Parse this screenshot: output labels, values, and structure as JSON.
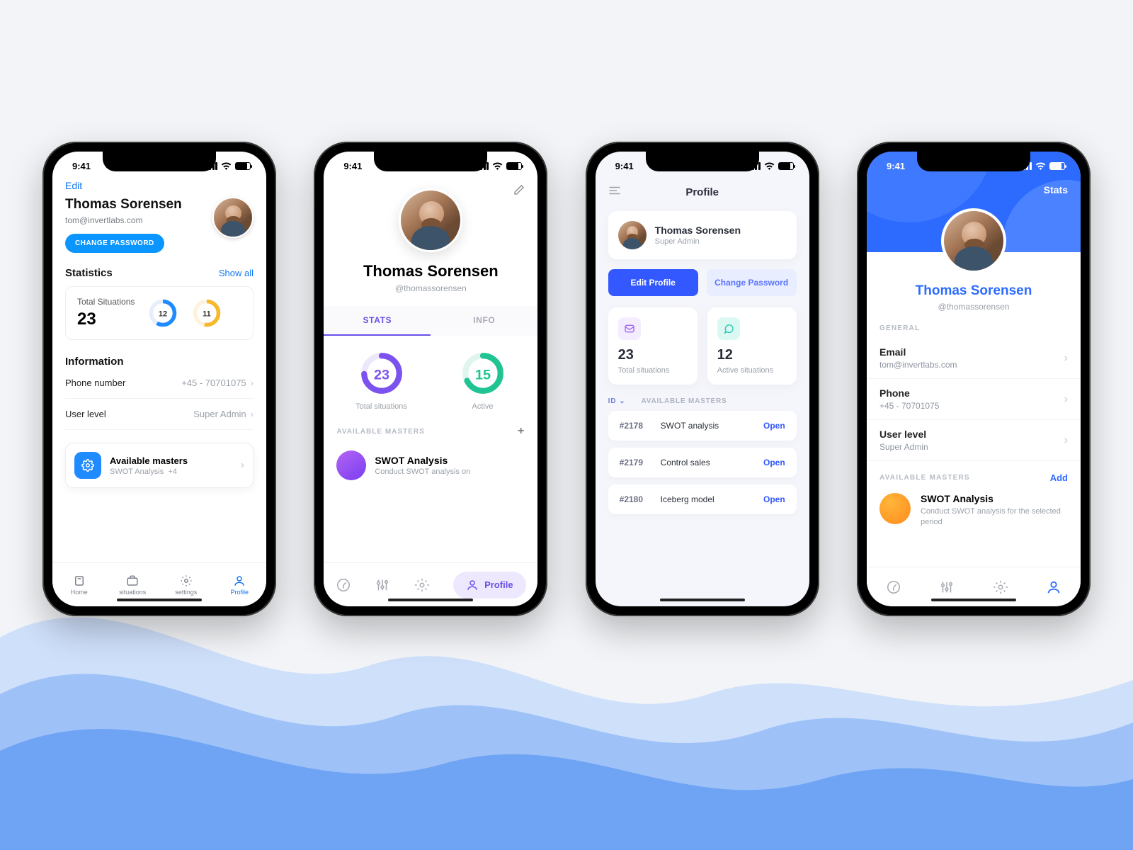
{
  "status": {
    "time": "9:41"
  },
  "screen1": {
    "edit": "Edit",
    "name": "Thomas Sorensen",
    "email": "tom@invertlabs.com",
    "change_pw": "CHANGE PASSWORD",
    "statistics_title": "Statistics",
    "show_all": "Show all",
    "total_situations_label": "Total Situations",
    "total_situations_value": "23",
    "donut1": "12",
    "donut2": "11",
    "information_title": "Information",
    "phone_label": "Phone number",
    "phone_value": "+45 - 70701075",
    "level_label": "User level",
    "level_value": "Super Admin",
    "masters_title": "Available masters",
    "masters_sub": "SWOT Analysis",
    "masters_extra": "+4",
    "tabs": {
      "home": "Home",
      "situations": "situations",
      "settings": "settings",
      "profile": "Profile"
    }
  },
  "screen2": {
    "name": "Thomas Sorensen",
    "handle": "@thomassorensen",
    "tab_stats": "STATS",
    "tab_info": "INFO",
    "total_value": "23",
    "total_label": "Total situations",
    "active_value": "15",
    "active_label": "Active",
    "section": "AVAILABLE MASTERS",
    "master_title": "SWOT Analysis",
    "master_sub": "Conduct SWOT analysis on",
    "profile_pill": "Profile"
  },
  "screen3": {
    "title": "Profile",
    "name": "Thomas Sorensen",
    "role": "Super Admin",
    "edit_btn": "Edit Profile",
    "pw_btn": "Change Password",
    "tile1_value": "23",
    "tile1_label": "Total situations",
    "tile2_value": "12",
    "tile2_label": "Active situations",
    "col_id": "ID",
    "col_masters": "AVAILABLE MASTERS",
    "rows": [
      {
        "id": "#2178",
        "title": "SWOT analysis",
        "action": "Open"
      },
      {
        "id": "#2179",
        "title": "Control sales",
        "action": "Open"
      },
      {
        "id": "#2180",
        "title": "Iceberg model",
        "action": "Open"
      }
    ]
  },
  "screen4": {
    "stats_link": "Stats",
    "name": "Thomas Sorensen",
    "handle": "@thomassorensen",
    "section_general": "GENERAL",
    "email_label": "Email",
    "email_value": "tom@invertlabs.com",
    "phone_label": "Phone",
    "phone_value": "+45 - 70701075",
    "level_label": "User level",
    "level_value": "Super Admin",
    "section_masters": "AVAILABLE MASTERS",
    "add": "Add",
    "master_title": "SWOT Analysis",
    "master_sub": "Conduct SWOT analysis for the selected period"
  }
}
